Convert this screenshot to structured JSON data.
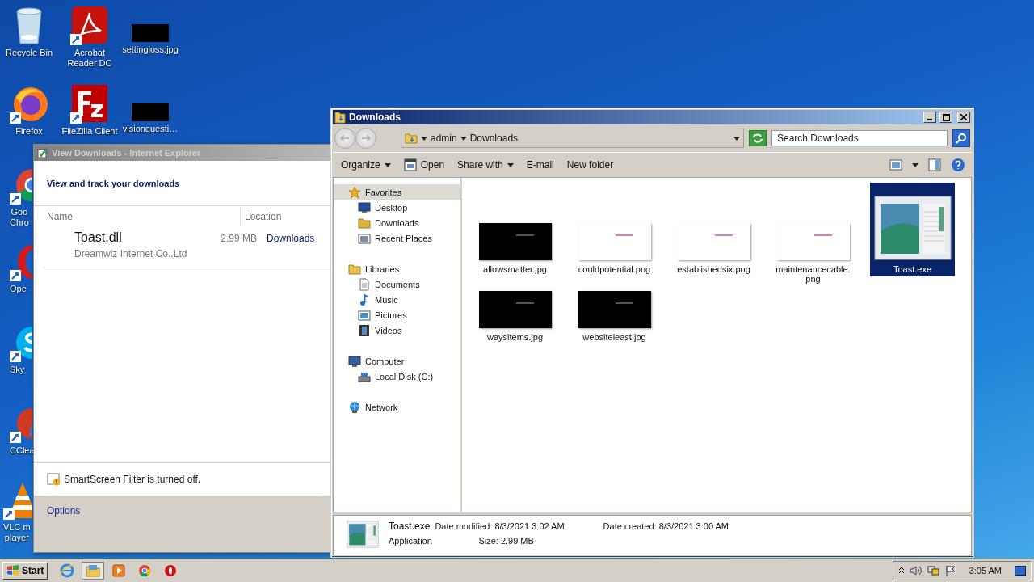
{
  "desktop_icons": [
    {
      "label": "Recycle Bin",
      "kind": "recycle"
    },
    {
      "label": "Acrobat Reader DC",
      "kind": "acrobat"
    },
    {
      "label": "settingloss.jpg",
      "kind": "image"
    },
    {
      "label": "Firefox",
      "kind": "firefox"
    },
    {
      "label": "FileZilla Client",
      "kind": "filezilla"
    },
    {
      "label": "visionquesti…",
      "kind": "image"
    },
    {
      "label": "Goo\nChro",
      "kind": "chrome"
    },
    {
      "label": "Ope",
      "kind": "opera"
    },
    {
      "label": "Sky",
      "kind": "skype"
    },
    {
      "label": "CClea",
      "kind": "ccleaner"
    },
    {
      "label": "VLC m\nplayer",
      "kind": "vlc"
    }
  ],
  "downloads_window": {
    "title": "View Downloads - Internet Explorer",
    "heading": "View and track your downloads",
    "columns": [
      "Name",
      "Location"
    ],
    "downloads": [
      {
        "name": "Toast.dll",
        "size": "2.99 MB",
        "publisher": "Dreamwiz Internet Co.,Ltd",
        "location": "Downloads"
      }
    ],
    "smartscreen": "SmartScreen Filter is turned off.",
    "options": "Options"
  },
  "explorer": {
    "title": "Downloads",
    "breadcrumb": [
      "admin",
      "Downloads"
    ],
    "search": {
      "placeholder": "Search Downloads"
    },
    "toolbar": [
      {
        "label": "Organize",
        "kind": "dropdown"
      },
      {
        "label": "Open",
        "kind": "icon"
      },
      {
        "label": "Share with",
        "kind": "dropdown"
      },
      {
        "label": "E-mail",
        "kind": "plain"
      },
      {
        "label": "New folder",
        "kind": "plain"
      }
    ],
    "nav": [
      {
        "label": "Favorites",
        "kind": "star",
        "selected": true,
        "children": [
          {
            "label": "Desktop",
            "kind": "desktop"
          },
          {
            "label": "Downloads",
            "kind": "downloads"
          },
          {
            "label": "Recent Places",
            "kind": "recent"
          }
        ]
      },
      {
        "label": "Libraries",
        "kind": "library",
        "selected": false,
        "children": [
          {
            "label": "Documents",
            "kind": "documents"
          },
          {
            "label": "Music",
            "kind": "music"
          },
          {
            "label": "Pictures",
            "kind": "pictures"
          },
          {
            "label": "Videos",
            "kind": "videos"
          }
        ]
      },
      {
        "label": "Computer",
        "kind": "computer",
        "selected": false,
        "children": [
          {
            "label": "Local Disk (C:)",
            "kind": "disk"
          }
        ]
      },
      {
        "label": "Network",
        "kind": "network",
        "selected": false
      }
    ],
    "files": [
      {
        "name": "allowsmatter.jpg",
        "kind": "dark",
        "selected": false
      },
      {
        "name": "couldpotential.png",
        "kind": "light",
        "selected": false
      },
      {
        "name": "establishedsix.png",
        "kind": "light",
        "selected": false
      },
      {
        "name": "maintenancecable.png",
        "kind": "light",
        "selected": false
      },
      {
        "name": "Toast.exe",
        "kind": "exe",
        "selected": true
      },
      {
        "name": "waysitems.jpg",
        "kind": "dark",
        "selected": false
      },
      {
        "name": "websiteleast.jpg",
        "kind": "dark",
        "selected": false
      }
    ],
    "details": {
      "name": "Toast.exe",
      "type": "Application",
      "fields": [
        {
          "label": "Date modified:",
          "value": "8/3/2021 3:02 AM"
        },
        {
          "label": "Date created:",
          "value": "8/3/2021 3:00 AM"
        },
        {
          "label": "Size:",
          "value": "2.99 MB"
        }
      ]
    }
  },
  "taskbar": {
    "start": "Start",
    "apps": [
      {
        "kind": "ie",
        "active": false
      },
      {
        "kind": "explorer",
        "active": true
      },
      {
        "kind": "media",
        "active": false
      },
      {
        "kind": "chrome",
        "active": false
      },
      {
        "kind": "opera",
        "active": false
      }
    ],
    "clock": "3:05 AM"
  }
}
